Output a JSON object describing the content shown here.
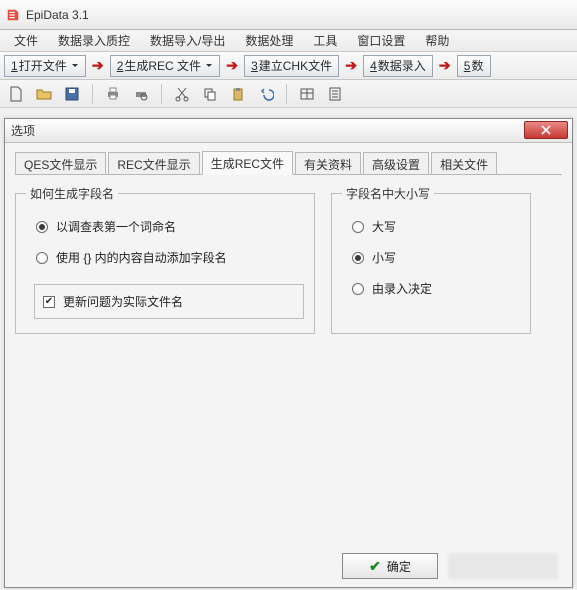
{
  "app": {
    "title": "EpiData 3.1"
  },
  "menu": {
    "items": [
      "文件",
      "数据录入质控",
      "数据导入/导出",
      "数据处理",
      "工具",
      "窗口设置",
      "帮助"
    ]
  },
  "steps": {
    "s1": {
      "key": "1",
      "label": "打开文件",
      "hasCaret": true
    },
    "s2": {
      "key": "2",
      "label": "生成REC 文件",
      "hasCaret": true
    },
    "s3": {
      "key": "3",
      "label": "建立CHK文件",
      "hasCaret": false
    },
    "s4": {
      "key": "4",
      "label": "数据录入",
      "hasCaret": false
    },
    "s5": {
      "key": "5",
      "label": "数",
      "hasCaret": false
    }
  },
  "toolbar": {
    "icons": [
      "new-file-icon",
      "open-folder-icon",
      "save-icon",
      "print-icon",
      "print-preview-icon",
      "cut-icon",
      "copy-icon",
      "paste-icon",
      "undo-icon",
      "table-icon",
      "form-icon"
    ]
  },
  "dialog": {
    "title": "选项",
    "tabs": [
      "QES文件显示",
      "REC文件显示",
      "生成REC文件",
      "有关资料",
      "高级设置",
      "相关文件"
    ],
    "activeTabIndex": 2,
    "group_fieldname": {
      "legend": "如何生成字段名",
      "opt1": "以调查表第一个词命名",
      "opt2": "使用 {} 内的内容自动添加字段名",
      "selected": 0,
      "checkbox_label": "更新问题为实际文件名",
      "checkbox_checked": true
    },
    "group_case": {
      "legend": "字段名中大小写",
      "opt1": "大写",
      "opt2": "小写",
      "opt3": "由录入决定",
      "selected": 1
    },
    "ok_label": "确定"
  }
}
